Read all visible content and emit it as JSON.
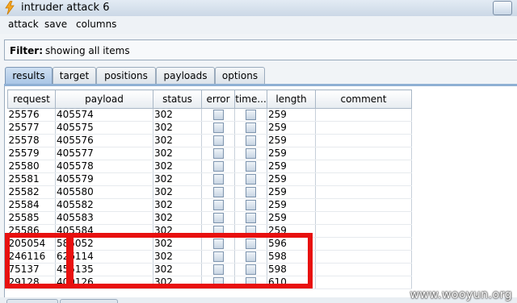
{
  "window": {
    "title": "intruder attack 6"
  },
  "menu": [
    "attack",
    "save",
    "columns"
  ],
  "filter": {
    "label": "Filter:",
    "value": "showing all items"
  },
  "tabs": [
    {
      "label": "results",
      "active": true
    },
    {
      "label": "target",
      "active": false
    },
    {
      "label": "positions",
      "active": false
    },
    {
      "label": "payloads",
      "active": false
    },
    {
      "label": "options",
      "active": false
    }
  ],
  "table": {
    "columns": [
      "request",
      "payload",
      "status",
      "error",
      "time...",
      "length",
      "comment"
    ],
    "rows": [
      {
        "request": "25576",
        "payload": "405574",
        "status": "302",
        "length": "259"
      },
      {
        "request": "25577",
        "payload": "405575",
        "status": "302",
        "length": "259"
      },
      {
        "request": "25578",
        "payload": "405576",
        "status": "302",
        "length": "259"
      },
      {
        "request": "25579",
        "payload": "405577",
        "status": "302",
        "length": "259"
      },
      {
        "request": "25580",
        "payload": "405578",
        "status": "302",
        "length": "259"
      },
      {
        "request": "25581",
        "payload": "405579",
        "status": "302",
        "length": "259"
      },
      {
        "request": "25582",
        "payload": "405580",
        "status": "302",
        "length": "259"
      },
      {
        "request": "25584",
        "payload": "405582",
        "status": "302",
        "length": "259"
      },
      {
        "request": "25585",
        "payload": "405583",
        "status": "302",
        "length": "259"
      },
      {
        "request": "25586",
        "payload": "405584",
        "status": "302",
        "length": "259"
      },
      {
        "request": "205054",
        "payload": "585052",
        "status": "302",
        "length": "596"
      },
      {
        "request": "246116",
        "payload": "626114",
        "status": "302",
        "length": "598"
      },
      {
        "request": "75137",
        "payload": "455135",
        "status": "302",
        "length": "598"
      },
      {
        "request": "29128",
        "payload": "409126",
        "status": "302",
        "length": "610"
      }
    ]
  },
  "watermark": "www.wooyun.org",
  "colors": {
    "highlight": "#e8100f",
    "tab_active": "#aac6e6"
  },
  "icons": {
    "app": "lightning-bolt-icon"
  }
}
